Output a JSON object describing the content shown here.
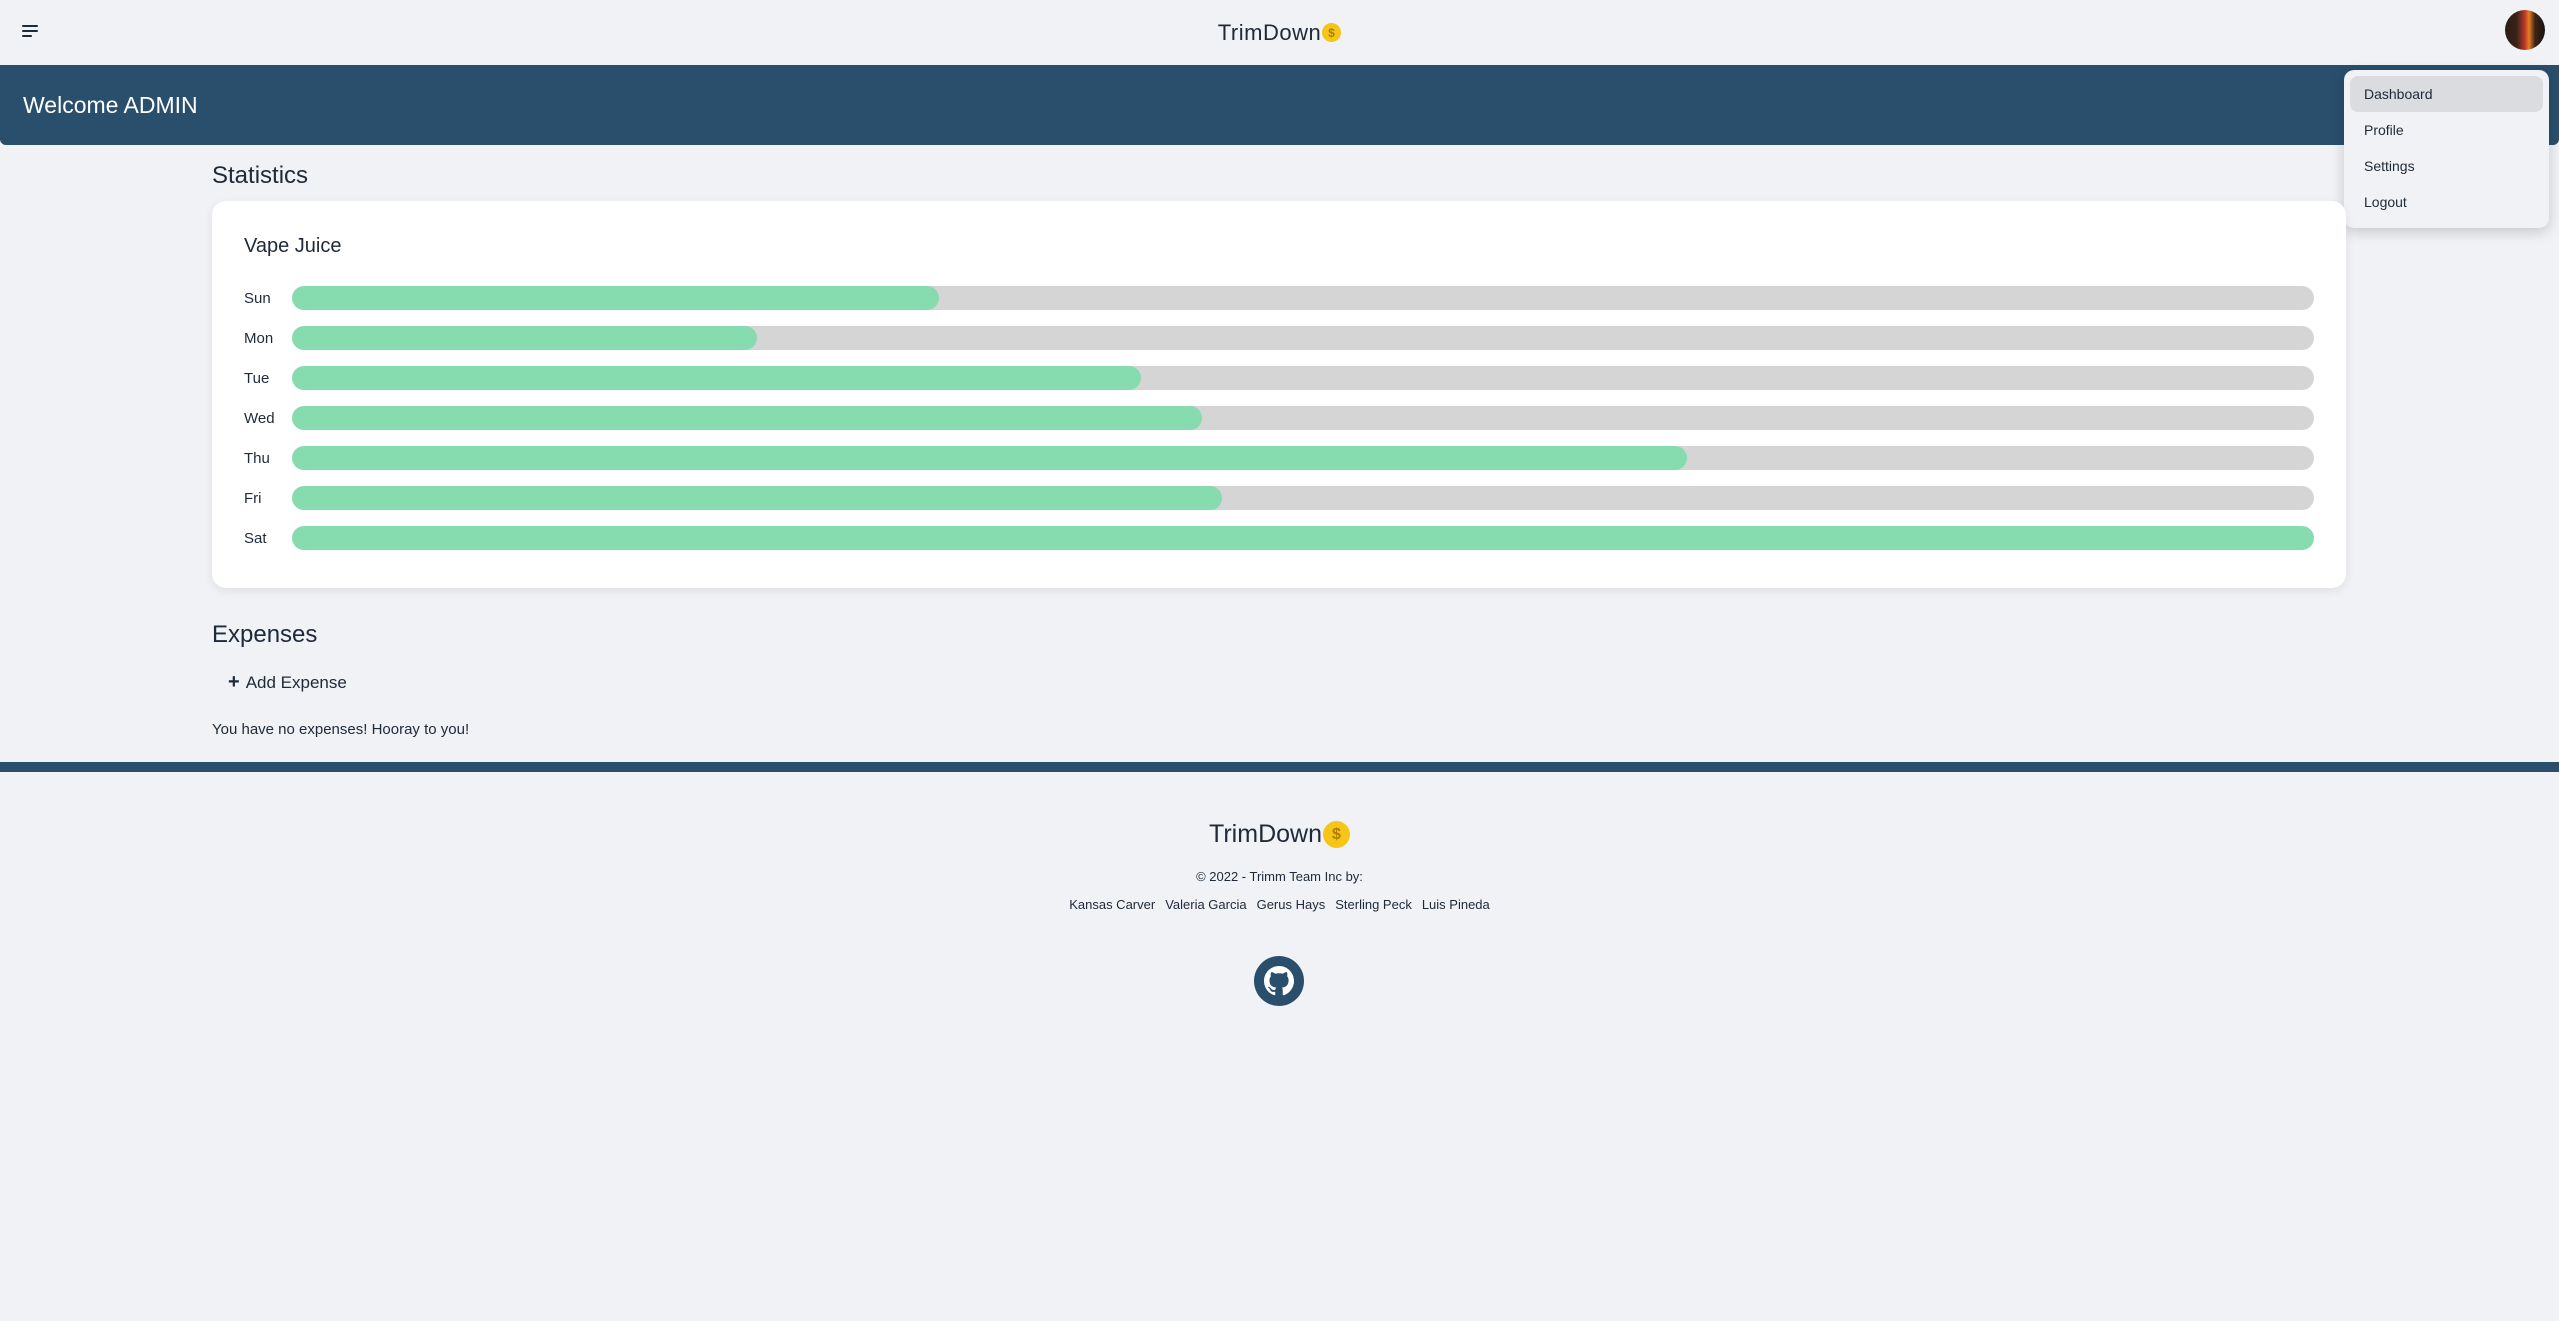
{
  "navbar": {
    "brand": "TrimDown",
    "coin_symbol": "$",
    "menu_icon": "hamburger-icon",
    "avatar_icon": "user-avatar"
  },
  "banner": {
    "welcome": "Welcome ADMIN"
  },
  "dropdown": {
    "items": [
      {
        "label": "Dashboard",
        "active": true
      },
      {
        "label": "Profile",
        "active": false
      },
      {
        "label": "Settings",
        "active": false
      },
      {
        "label": "Logout",
        "active": false
      }
    ]
  },
  "statistics": {
    "title": "Statistics",
    "card_title": "Vape Juice",
    "chart_data": {
      "type": "bar",
      "orientation": "horizontal",
      "categories": [
        "Sun",
        "Mon",
        "Tue",
        "Wed",
        "Thu",
        "Fri",
        "Sat"
      ],
      "values": [
        0.32,
        0.23,
        0.42,
        0.45,
        0.69,
        0.46,
        1.0
      ],
      "fill_color": "#86dcae",
      "track_color": "#d5d5d5"
    }
  },
  "expenses": {
    "title": "Expenses",
    "add_label": "Add Expense",
    "add_icon": "plus-icon",
    "empty_message": "You have no expenses! Hooray to you!"
  },
  "footer": {
    "brand": "TrimDown",
    "coin_symbol": "$",
    "copyright": "© 2022 - Trimm Team Inc by:",
    "authors": [
      "Kansas Carver",
      "Valeria Garcia",
      "Gerus Hays",
      "Sterling Peck",
      "Luis Pineda"
    ],
    "github_icon": "github-icon"
  },
  "colors": {
    "primary": "#294f6d",
    "background": "#f0f2f5",
    "bar_fill": "#86dcae",
    "bar_track": "#d5d5d5",
    "coin": "#f5c518"
  }
}
